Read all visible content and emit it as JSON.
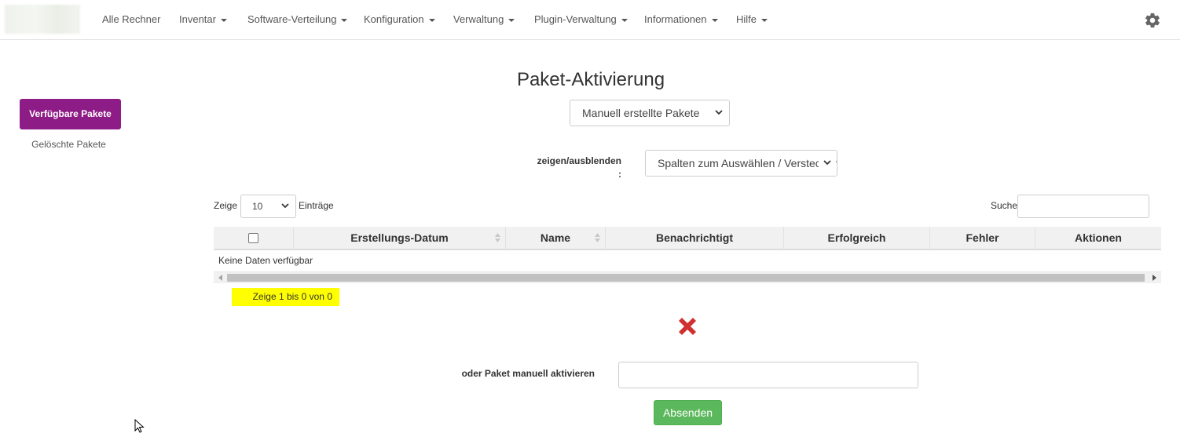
{
  "nav": {
    "items": [
      {
        "label": "Alle Rechner",
        "dropdown": false
      },
      {
        "label": "Inventar",
        "dropdown": true
      },
      {
        "label": "Software-Verteilung",
        "dropdown": true
      },
      {
        "label": "Konfiguration",
        "dropdown": true
      },
      {
        "label": "Verwaltung",
        "dropdown": true
      },
      {
        "label": "Plugin-Verwaltung",
        "dropdown": true
      },
      {
        "label": "Informationen",
        "dropdown": true
      },
      {
        "label": "Hilfe",
        "dropdown": true
      }
    ],
    "settings_icon": "gear-icon"
  },
  "sidebar": {
    "items": [
      {
        "label": "Verfügbare Pakete",
        "active": true
      },
      {
        "label": "Gelöschte Pakete",
        "active": false
      }
    ],
    "active_color": "#8e1c86"
  },
  "main": {
    "title": "Paket-Aktivierung",
    "package_type_select": "Manuell erstellte Pakete",
    "columns_label": "zeigen/ausblenden",
    "columns_label_suffix": ":",
    "columns_select": "Spalten zum Auswählen / Verstecken",
    "length": {
      "prefix": "Zeige",
      "value": "10",
      "suffix": "Einträge"
    },
    "search_label": "Suche",
    "search_value": "",
    "table": {
      "columns": [
        "",
        "Erstellungs-Datum",
        "Name",
        "Benachrichtigt",
        "Erfolgreich",
        "Fehler",
        "Aktionen"
      ],
      "empty_text": "Keine Daten verfügbar"
    },
    "info_text": "Zeige 1 bis 0 von 0",
    "info_highlight_color": "#ffff00",
    "manual_label": "oder Paket manuell aktivieren",
    "manual_value": "",
    "submit_label": "Absenden",
    "submit_color": "#5cb85c",
    "error_icon": "x-icon",
    "error_color": "#d03030"
  }
}
